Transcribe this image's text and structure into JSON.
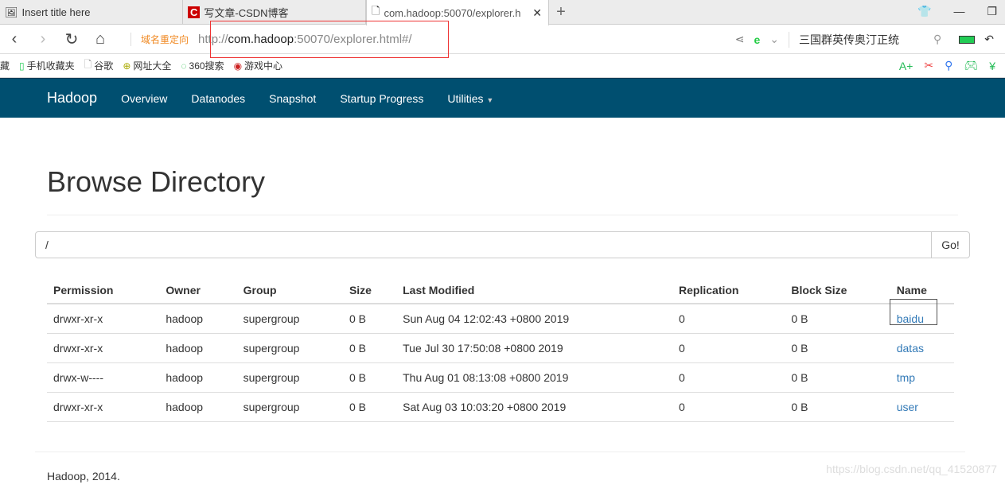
{
  "browser": {
    "tabs": [
      {
        "label": "Insert title here"
      },
      {
        "label": "写文章-CSDN博客"
      },
      {
        "label": "com.hadoop:50070/explorer.h"
      }
    ],
    "url_prefix": "http://",
    "url_host": "com.hadoop",
    "url_rest": ":50070/explorer.html#/",
    "redirect_label": "域名重定向",
    "search_text": "三国群英传奥汀正统",
    "bookmarks": [
      "藏",
      "手机收藏夹",
      "谷歌",
      "网址大全",
      "360搜索",
      "游戏中心"
    ]
  },
  "navbar": {
    "brand": "Hadoop",
    "items": [
      "Overview",
      "Datanodes",
      "Snapshot",
      "Startup Progress",
      "Utilities"
    ]
  },
  "page": {
    "title": "Browse Directory",
    "path": "/",
    "go_label": "Go!"
  },
  "table": {
    "headers": [
      "Permission",
      "Owner",
      "Group",
      "Size",
      "Last Modified",
      "Replication",
      "Block Size",
      "Name"
    ],
    "rows": [
      [
        "drwxr-xr-x",
        "hadoop",
        "supergroup",
        "0 B",
        "Sun Aug 04 12:02:43 +0800 2019",
        "0",
        "0 B",
        "baidu"
      ],
      [
        "drwxr-xr-x",
        "hadoop",
        "supergroup",
        "0 B",
        "Tue Jul 30 17:50:08 +0800 2019",
        "0",
        "0 B",
        "datas"
      ],
      [
        "drwx-w----",
        "hadoop",
        "supergroup",
        "0 B",
        "Thu Aug 01 08:13:08 +0800 2019",
        "0",
        "0 B",
        "tmp"
      ],
      [
        "drwxr-xr-x",
        "hadoop",
        "supergroup",
        "0 B",
        "Sat Aug 03 10:03:20 +0800 2019",
        "0",
        "0 B",
        "user"
      ]
    ]
  },
  "footer": "Hadoop, 2014.",
  "watermark": "https://blog.csdn.net/qq_41520877",
  "colors": {
    "navbar": "#004f70",
    "link": "#337ab7",
    "highlight": "#e33333"
  }
}
